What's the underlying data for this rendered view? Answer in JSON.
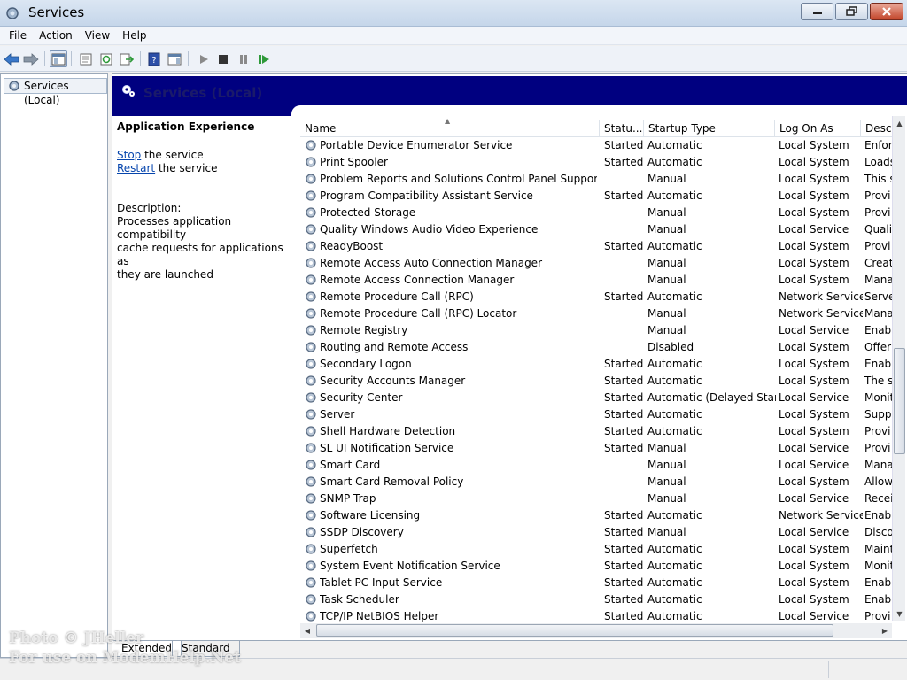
{
  "window": {
    "title": "Services"
  },
  "menu": [
    "File",
    "Action",
    "View",
    "Help"
  ],
  "tree": {
    "root_label": "Services (Local)"
  },
  "header": {
    "title": "Services (Local)"
  },
  "details": {
    "service_name": "Application Experience",
    "stop_link": "Stop",
    "stop_suffix": " the service",
    "restart_link": "Restart",
    "restart_suffix": " the service",
    "description_label": "Description:",
    "description_lines": [
      "Processes application compatibility",
      "cache requests for applications as",
      "they are launched"
    ]
  },
  "columns": {
    "name": "Name",
    "status": "Statu...",
    "startup": "Startup Type",
    "logon": "Log On As",
    "desc": "Descr"
  },
  "services": [
    {
      "name": "Portable Device Enumerator Service",
      "status": "Started",
      "startup": "Automatic",
      "logon": "Local System",
      "desc": "Enfor"
    },
    {
      "name": "Print Spooler",
      "status": "Started",
      "startup": "Automatic",
      "logon": "Local System",
      "desc": "Loads"
    },
    {
      "name": "Problem Reports and Solutions Control Panel Support",
      "status": "",
      "startup": "Manual",
      "logon": "Local System",
      "desc": "This s"
    },
    {
      "name": "Program Compatibility Assistant Service",
      "status": "Started",
      "startup": "Automatic",
      "logon": "Local System",
      "desc": "Provi"
    },
    {
      "name": "Protected Storage",
      "status": "",
      "startup": "Manual",
      "logon": "Local System",
      "desc": "Provi"
    },
    {
      "name": "Quality Windows Audio Video Experience",
      "status": "",
      "startup": "Manual",
      "logon": "Local Service",
      "desc": "Quali"
    },
    {
      "name": "ReadyBoost",
      "status": "Started",
      "startup": "Automatic",
      "logon": "Local System",
      "desc": "Provi"
    },
    {
      "name": "Remote Access Auto Connection Manager",
      "status": "",
      "startup": "Manual",
      "logon": "Local System",
      "desc": "Creat"
    },
    {
      "name": "Remote Access Connection Manager",
      "status": "",
      "startup": "Manual",
      "logon": "Local System",
      "desc": "Mana"
    },
    {
      "name": "Remote Procedure Call (RPC)",
      "status": "Started",
      "startup": "Automatic",
      "logon": "Network Service",
      "desc": "Serve"
    },
    {
      "name": "Remote Procedure Call (RPC) Locator",
      "status": "",
      "startup": "Manual",
      "logon": "Network Service",
      "desc": "Mana"
    },
    {
      "name": "Remote Registry",
      "status": "",
      "startup": "Manual",
      "logon": "Local Service",
      "desc": "Enabl"
    },
    {
      "name": "Routing and Remote Access",
      "status": "",
      "startup": "Disabled",
      "logon": "Local System",
      "desc": "Offer"
    },
    {
      "name": "Secondary Logon",
      "status": "Started",
      "startup": "Automatic",
      "logon": "Local System",
      "desc": "Enabl"
    },
    {
      "name": "Security Accounts Manager",
      "status": "Started",
      "startup": "Automatic",
      "logon": "Local System",
      "desc": "The s"
    },
    {
      "name": "Security Center",
      "status": "Started",
      "startup": "Automatic (Delayed Start)",
      "logon": "Local Service",
      "desc": "Monit"
    },
    {
      "name": "Server",
      "status": "Started",
      "startup": "Automatic",
      "logon": "Local System",
      "desc": "Suppo"
    },
    {
      "name": "Shell Hardware Detection",
      "status": "Started",
      "startup": "Automatic",
      "logon": "Local System",
      "desc": "Provi"
    },
    {
      "name": "SL UI Notification Service",
      "status": "Started",
      "startup": "Manual",
      "logon": "Local Service",
      "desc": "Provi"
    },
    {
      "name": "Smart Card",
      "status": "",
      "startup": "Manual",
      "logon": "Local Service",
      "desc": "Mana"
    },
    {
      "name": "Smart Card Removal Policy",
      "status": "",
      "startup": "Manual",
      "logon": "Local System",
      "desc": "Allow"
    },
    {
      "name": "SNMP Trap",
      "status": "",
      "startup": "Manual",
      "logon": "Local Service",
      "desc": "Recei"
    },
    {
      "name": "Software Licensing",
      "status": "Started",
      "startup": "Automatic",
      "logon": "Network Service",
      "desc": "Enabl"
    },
    {
      "name": "SSDP Discovery",
      "status": "Started",
      "startup": "Manual",
      "logon": "Local Service",
      "desc": "Disco"
    },
    {
      "name": "Superfetch",
      "status": "Started",
      "startup": "Automatic",
      "logon": "Local System",
      "desc": "Maint"
    },
    {
      "name": "System Event Notification Service",
      "status": "Started",
      "startup": "Automatic",
      "logon": "Local System",
      "desc": "Monit"
    },
    {
      "name": "Tablet PC Input Service",
      "status": "Started",
      "startup": "Automatic",
      "logon": "Local System",
      "desc": "Enabl"
    },
    {
      "name": "Task Scheduler",
      "status": "Started",
      "startup": "Automatic",
      "logon": "Local System",
      "desc": "Enabl"
    },
    {
      "name": "TCP/IP NetBIOS Helper",
      "status": "Started",
      "startup": "Automatic",
      "logon": "Local Service",
      "desc": "Provi"
    }
  ],
  "tabs": {
    "extended": "Extended",
    "standard": "Standard"
  },
  "watermark": {
    "line1": "Photo © JHeller",
    "line2": "For use on ModemHelp.Net"
  }
}
